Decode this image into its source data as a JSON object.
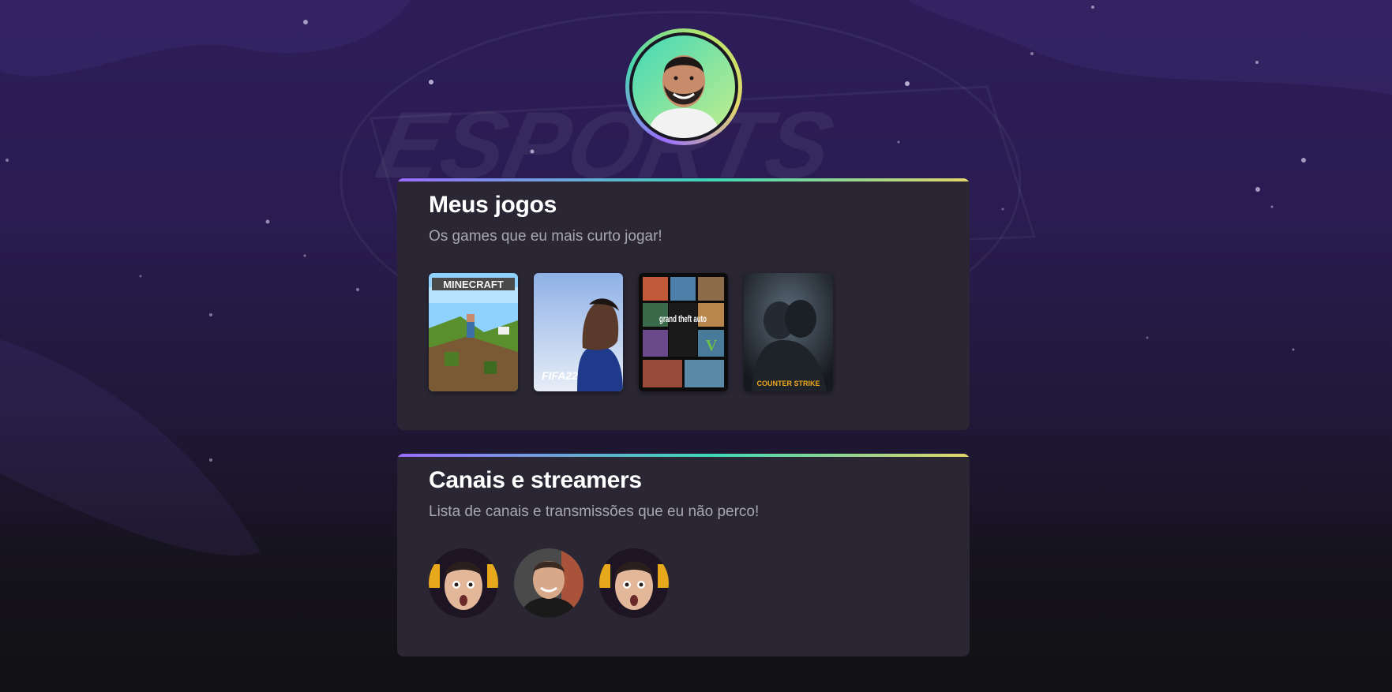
{
  "profile": {
    "avatar_alt": "profile-photo"
  },
  "games_section": {
    "title": "Meus jogos",
    "subtitle": "Os games que eu mais curto jogar!",
    "games": [
      {
        "name": "minecraft",
        "cover_text": "MINECRAFT"
      },
      {
        "name": "fifa-22",
        "cover_text": "FIFA22"
      },
      {
        "name": "gta-v",
        "cover_text": "grand theft auto"
      },
      {
        "name": "counter-strike",
        "cover_text": "COUNTER STRIKE"
      }
    ]
  },
  "streams_section": {
    "title": "Canais e streamers",
    "subtitle": "Lista de canais e transmissões que eu não perco!",
    "streamers": [
      {
        "name": "streamer-1"
      },
      {
        "name": "streamer-2"
      },
      {
        "name": "streamer-3"
      }
    ]
  },
  "colors": {
    "gradient_start": "#9a6dff",
    "gradient_mid": "#3fd8b8",
    "gradient_end": "#e2d56a",
    "card_bg": "#2a2634",
    "page_bg_top": "#2c1d59",
    "page_bg_bottom": "#121115"
  }
}
